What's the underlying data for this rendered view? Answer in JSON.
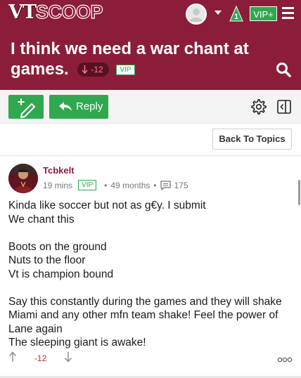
{
  "header": {
    "logo_vt": "VT",
    "logo_scoop": "SCOOP",
    "notification_count": "1",
    "vip_plus_label": "VIP+",
    "colors": {
      "brand": "#8c1d3a",
      "accent": "#2fa84f"
    }
  },
  "thread": {
    "title": "I think we need a war chant at games.",
    "vote_score": "-12",
    "vip_label": "VIP"
  },
  "toolbar": {
    "reply_label": "Reply",
    "back_label": "Back To Topics",
    "icons": [
      "new-post-icon",
      "reply-arrow-icon",
      "gear-icon",
      "panel-toggle-icon"
    ]
  },
  "post": {
    "username": "Tcbkelt",
    "time": "19 mins",
    "vip_label": "VIP",
    "separator": "•",
    "member_age": "49 months",
    "post_count": "175",
    "paragraphs": [
      [
        "Kinda like soccer but not as g€y. I submit",
        "We chant this"
      ],
      [
        "Boots on the ground",
        "Nuts to the floor",
        "Vt is champion bound"
      ],
      [
        "Say this constantly during the games and they will shake Miami and any other mfn team shake! Feel the power of Lane again",
        "The sleeping giant is awake!"
      ]
    ],
    "score": "-12",
    "more_label": "ooo"
  }
}
